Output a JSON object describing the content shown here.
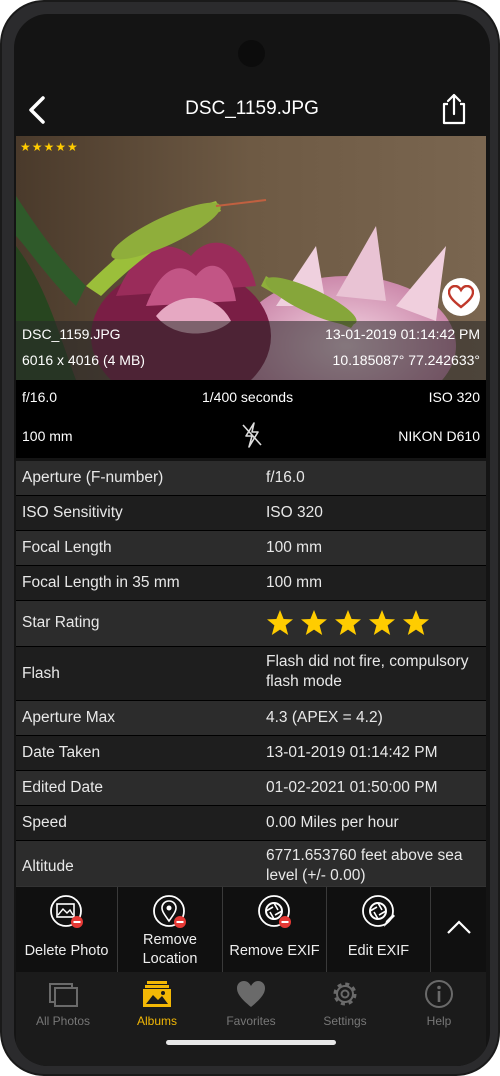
{
  "header": {
    "title": "DSC_1159.JPG"
  },
  "photo": {
    "star_text": "★★★★★",
    "filename": "DSC_1159.JPG",
    "datetime": "13-01-2019 01:14:42 PM",
    "dimensions": "6016 x 4016 (4 MB)",
    "coordinates": "10.185087° 77.242633°"
  },
  "summary": {
    "aperture": "f/16.0",
    "shutter": "1/400 seconds",
    "iso": "ISO 320",
    "focal": "100 mm",
    "camera": "NIKON D610"
  },
  "details": [
    {
      "key": "Aperture (F-number)",
      "value": "f/16.0"
    },
    {
      "key": "ISO Sensitivity",
      "value": "ISO 320"
    },
    {
      "key": "Focal Length",
      "value": "100 mm"
    },
    {
      "key": "Focal Length in 35 mm",
      "value": "100 mm"
    },
    {
      "key": "Star Rating",
      "rating": 5
    },
    {
      "key": "Flash",
      "value": "Flash did not fire, compulsory flash mode"
    },
    {
      "key": "Aperture Max",
      "value": "4.3 (APEX = 4.2)"
    },
    {
      "key": "Date Taken",
      "value": "13-01-2019 01:14:42 PM"
    },
    {
      "key": "Edited Date",
      "value": "01-02-2021 01:50:00 PM"
    },
    {
      "key": "Speed",
      "value": "0.00 Miles per hour"
    },
    {
      "key": "Altitude",
      "value": "6771.653760 feet above sea level (+/- 0.00)"
    }
  ],
  "actions": {
    "delete_photo": "Delete Photo",
    "remove_location_1": "Remove",
    "remove_location_2": "Location",
    "remove_exif": "Remove EXIF",
    "edit_exif": "Edit EXIF"
  },
  "tabs": {
    "all_photos": "All Photos",
    "albums": "Albums",
    "favorites": "Favorites",
    "settings": "Settings",
    "help": "Help"
  },
  "colors": {
    "accent": "#f2b705",
    "star": "#ffcc00",
    "heart": "#c0392b",
    "remove_badge": "#e53935"
  }
}
